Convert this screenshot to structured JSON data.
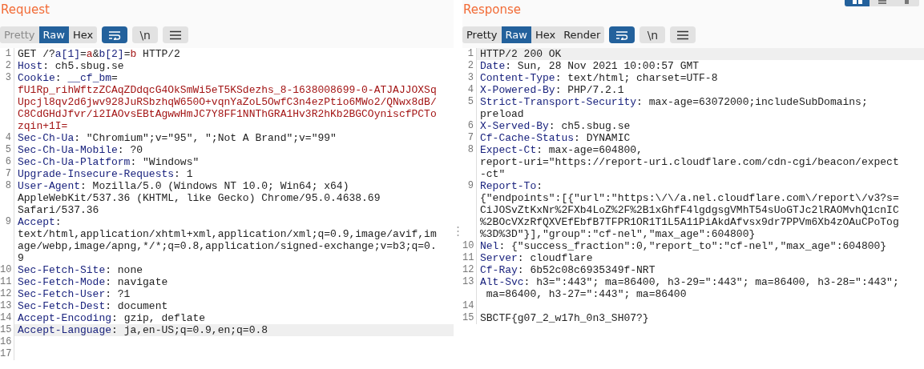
{
  "layout_buttons": [
    {
      "kind": "side-by-side",
      "selected": true
    },
    {
      "kind": "stacked",
      "selected": false
    },
    {
      "kind": "single",
      "selected": false
    }
  ],
  "panels": [
    {
      "title": "Request",
      "view_tabs": [
        {
          "label": "Pretty",
          "selected": false,
          "disabled": true
        },
        {
          "label": "Raw",
          "selected": true,
          "disabled": false
        },
        {
          "label": "Hex",
          "selected": false,
          "disabled": false
        }
      ],
      "toggles": [
        {
          "kind": "wrap",
          "on": true
        },
        {
          "kind": "newline",
          "label": "\\n",
          "on": false
        },
        {
          "kind": "menu",
          "on": false
        }
      ],
      "lines": [
        {
          "number": "1",
          "highlighted": false,
          "rows": [
            [
              {
                "kind": "text",
                "text": "GET /?"
              },
              {
                "kind": "key",
                "text": "a[1]"
              },
              {
                "kind": "text",
                "text": "="
              },
              {
                "kind": "param",
                "text": "a"
              },
              {
                "kind": "text",
                "text": "&"
              },
              {
                "kind": "key",
                "text": "b[2]"
              },
              {
                "kind": "text",
                "text": "="
              },
              {
                "kind": "param",
                "text": "b"
              },
              {
                "kind": "text",
                "text": " HTTP/2"
              }
            ]
          ]
        },
        {
          "number": "2",
          "highlighted": false,
          "rows": [
            [
              {
                "kind": "key",
                "text": "Host"
              },
              {
                "kind": "text",
                "text": ": ch5.sbug.se"
              }
            ]
          ]
        },
        {
          "number": "3",
          "highlighted": false,
          "rows": [
            [
              {
                "kind": "key",
                "text": "Cookie"
              },
              {
                "kind": "text",
                "text": ": "
              },
              {
                "kind": "key",
                "text": "__cf_bm"
              },
              {
                "kind": "text",
                "text": "="
              }
            ],
            [
              {
                "kind": "param",
                "text": "fU1Rp_rihWftzZCAqZDdqcG4OkSmWi5eT5KSdezhs_8-1638008699-0-ATJAJJOXSq"
              }
            ],
            [
              {
                "kind": "param",
                "text": "Upcjl8qv2d6jwv928JuRSbzhqW650O+vqnYaZoL5OwfC3n4ezPtio6MWo2/QNwx8dB/"
              }
            ],
            [
              {
                "kind": "param",
                "text": "C8CdGHdJfvr/i2IAOvsEBtAgwwHmJC7Y8FF1NNThGRA1Hv3R2hKb2BGCOyniscfPCTo"
              }
            ],
            [
              {
                "kind": "param",
                "text": "zqin+1I="
              }
            ]
          ]
        },
        {
          "number": "4",
          "highlighted": false,
          "rows": [
            [
              {
                "kind": "key",
                "text": "Sec-Ch-Ua"
              },
              {
                "kind": "text",
                "text": ": \"Chromium\";v=\"95\", \";Not A Brand\";v=\"99\""
              }
            ]
          ]
        },
        {
          "number": "5",
          "highlighted": false,
          "rows": [
            [
              {
                "kind": "key",
                "text": "Sec-Ch-Ua-Mobile"
              },
              {
                "kind": "text",
                "text": ": ?0"
              }
            ]
          ]
        },
        {
          "number": "6",
          "highlighted": false,
          "rows": [
            [
              {
                "kind": "key",
                "text": "Sec-Ch-Ua-Platform"
              },
              {
                "kind": "text",
                "text": ": \"Windows\""
              }
            ]
          ]
        },
        {
          "number": "7",
          "highlighted": false,
          "rows": [
            [
              {
                "kind": "key",
                "text": "Upgrade-Insecure-Requests"
              },
              {
                "kind": "text",
                "text": ": 1"
              }
            ]
          ]
        },
        {
          "number": "8",
          "highlighted": false,
          "rows": [
            [
              {
                "kind": "key",
                "text": "User-Agent"
              },
              {
                "kind": "text",
                "text": ": Mozilla/5.0 (Windows NT 10.0; Win64; x64)"
              }
            ],
            [
              {
                "kind": "text",
                "text": "AppleWebKit/537.36 (KHTML, like Gecko) Chrome/95.0.4638.69"
              }
            ],
            [
              {
                "kind": "text",
                "text": "Safari/537.36"
              }
            ]
          ]
        },
        {
          "number": "9",
          "highlighted": false,
          "rows": [
            [
              {
                "kind": "key",
                "text": "Accept"
              },
              {
                "kind": "text",
                "text": ":"
              }
            ],
            [
              {
                "kind": "text",
                "text": "text/html,application/xhtml+xml,application/xml;q=0.9,image/avif,im"
              }
            ],
            [
              {
                "kind": "text",
                "text": "age/webp,image/apng,*/*;q=0.8,application/signed-exchange;v=b3;q=0."
              }
            ],
            [
              {
                "kind": "text",
                "text": "9"
              }
            ]
          ]
        },
        {
          "number": "10",
          "highlighted": false,
          "rows": [
            [
              {
                "kind": "key",
                "text": "Sec-Fetch-Site"
              },
              {
                "kind": "text",
                "text": ": none"
              }
            ]
          ]
        },
        {
          "number": "11",
          "highlighted": false,
          "rows": [
            [
              {
                "kind": "key",
                "text": "Sec-Fetch-Mode"
              },
              {
                "kind": "text",
                "text": ": navigate"
              }
            ]
          ]
        },
        {
          "number": "12",
          "highlighted": false,
          "rows": [
            [
              {
                "kind": "key",
                "text": "Sec-Fetch-User"
              },
              {
                "kind": "text",
                "text": ": ?1"
              }
            ]
          ]
        },
        {
          "number": "13",
          "highlighted": false,
          "rows": [
            [
              {
                "kind": "key",
                "text": "Sec-Fetch-Dest"
              },
              {
                "kind": "text",
                "text": ": document"
              }
            ]
          ]
        },
        {
          "number": "14",
          "highlighted": false,
          "rows": [
            [
              {
                "kind": "key",
                "text": "Accept-Encoding"
              },
              {
                "kind": "text",
                "text": ": gzip, deflate"
              }
            ]
          ]
        },
        {
          "number": "15",
          "highlighted": true,
          "rows": [
            [
              {
                "kind": "key",
                "text": "Accept-Language"
              },
              {
                "kind": "text",
                "text": ": ja,en-US;q=0.9,en;q=0.8"
              }
            ]
          ]
        },
        {
          "number": "16",
          "highlighted": false,
          "rows": [
            []
          ]
        },
        {
          "number": "17",
          "highlighted": false,
          "rows": [
            []
          ]
        }
      ]
    },
    {
      "title": "Response",
      "view_tabs": [
        {
          "label": "Pretty",
          "selected": false,
          "disabled": false
        },
        {
          "label": "Raw",
          "selected": true,
          "disabled": false
        },
        {
          "label": "Hex",
          "selected": false,
          "disabled": false
        },
        {
          "label": "Render",
          "selected": false,
          "disabled": false
        }
      ],
      "toggles": [
        {
          "kind": "wrap",
          "on": true
        },
        {
          "kind": "newline",
          "label": "\\n",
          "on": false
        },
        {
          "kind": "menu",
          "on": false
        }
      ],
      "lines": [
        {
          "number": "1",
          "highlighted": true,
          "rows": [
            [
              {
                "kind": "text",
                "text": "HTTP/2 200 OK"
              }
            ]
          ]
        },
        {
          "number": "2",
          "highlighted": false,
          "rows": [
            [
              {
                "kind": "key",
                "text": "Date"
              },
              {
                "kind": "text",
                "text": ": Sun, 28 Nov 2021 10:00:57 GMT"
              }
            ]
          ]
        },
        {
          "number": "3",
          "highlighted": false,
          "rows": [
            [
              {
                "kind": "key",
                "text": "Content-Type"
              },
              {
                "kind": "text",
                "text": ": text/html; charset=UTF-8"
              }
            ]
          ]
        },
        {
          "number": "4",
          "highlighted": false,
          "rows": [
            [
              {
                "kind": "key",
                "text": "X-Powered-By"
              },
              {
                "kind": "text",
                "text": ": PHP/7.2.1"
              }
            ]
          ]
        },
        {
          "number": "5",
          "highlighted": false,
          "rows": [
            [
              {
                "kind": "key",
                "text": "Strict-Transport-Security"
              },
              {
                "kind": "text",
                "text": ": max-age=63072000;includeSubDomains;"
              }
            ],
            [
              {
                "kind": "text",
                "text": "preload"
              }
            ]
          ]
        },
        {
          "number": "6",
          "highlighted": false,
          "rows": [
            [
              {
                "kind": "key",
                "text": "X-Served-By"
              },
              {
                "kind": "text",
                "text": ": ch5.sbug.se"
              }
            ]
          ]
        },
        {
          "number": "7",
          "highlighted": false,
          "rows": [
            [
              {
                "kind": "key",
                "text": "Cf-Cache-Status"
              },
              {
                "kind": "text",
                "text": ": DYNAMIC"
              }
            ]
          ]
        },
        {
          "number": "8",
          "highlighted": false,
          "rows": [
            [
              {
                "kind": "key",
                "text": "Expect-Ct"
              },
              {
                "kind": "text",
                "text": ": max-age=604800,"
              }
            ],
            [
              {
                "kind": "text",
                "text": "report-uri=\"https://report-uri.cloudflare.com/cdn-cgi/beacon/expect"
              }
            ],
            [
              {
                "kind": "text",
                "text": "-ct\""
              }
            ]
          ]
        },
        {
          "number": "9",
          "highlighted": false,
          "rows": [
            [
              {
                "kind": "key",
                "text": "Report-To"
              },
              {
                "kind": "text",
                "text": ":"
              }
            ],
            [
              {
                "kind": "text",
                "text": "{\"endpoints\":[{\"url\":\"https:\\/\\/a.nel.cloudflare.com\\/report\\/v3?s="
              }
            ],
            [
              {
                "kind": "text",
                "text": "CiJOSvZtKxNr%2FXb4LoZ%2F%2B1xGhfF4lgdgsgVMhT54sUoGTJc2lRAOMvhQ1cnIC"
              }
            ],
            [
              {
                "kind": "text",
                "text": "%2BOcVXzRfQXVEfEbfB7TFPR1OR1T1L5A11PiAkdAfvsx9dr7PPVm6Xb4zOAuCPoTog"
              }
            ],
            [
              {
                "kind": "text",
                "text": "%3D%3D\"}],\"group\":\"cf-nel\",\"max_age\":604800}"
              }
            ]
          ]
        },
        {
          "number": "10",
          "highlighted": false,
          "rows": [
            [
              {
                "kind": "key",
                "text": "Nel"
              },
              {
                "kind": "text",
                "text": ": {\"success_fraction\":0,\"report_to\":\"cf-nel\",\"max_age\":604800}"
              }
            ]
          ]
        },
        {
          "number": "11",
          "highlighted": false,
          "rows": [
            [
              {
                "kind": "key",
                "text": "Server"
              },
              {
                "kind": "text",
                "text": ": cloudflare"
              }
            ]
          ]
        },
        {
          "number": "12",
          "highlighted": false,
          "rows": [
            [
              {
                "kind": "key",
                "text": "Cf-Ray"
              },
              {
                "kind": "text",
                "text": ": 6b52c08c6935349f-NRT"
              }
            ]
          ]
        },
        {
          "number": "13",
          "highlighted": false,
          "rows": [
            [
              {
                "kind": "key",
                "text": "Alt-Svc"
              },
              {
                "kind": "text",
                "text": ": h3=\":443\"; ma=86400, h3-29=\":443\"; ma=86400, h3-28=\":443\";"
              }
            ],
            [
              {
                "kind": "text",
                "text": " ma=86400, h3-27=\":443\"; ma=86400"
              }
            ]
          ]
        },
        {
          "number": "14",
          "highlighted": false,
          "rows": [
            []
          ]
        },
        {
          "number": "15",
          "highlighted": false,
          "rows": [
            [
              {
                "kind": "text",
                "text": "SBCTF{g07_2_w17h_0n3_SH07?}"
              }
            ]
          ]
        }
      ]
    }
  ]
}
